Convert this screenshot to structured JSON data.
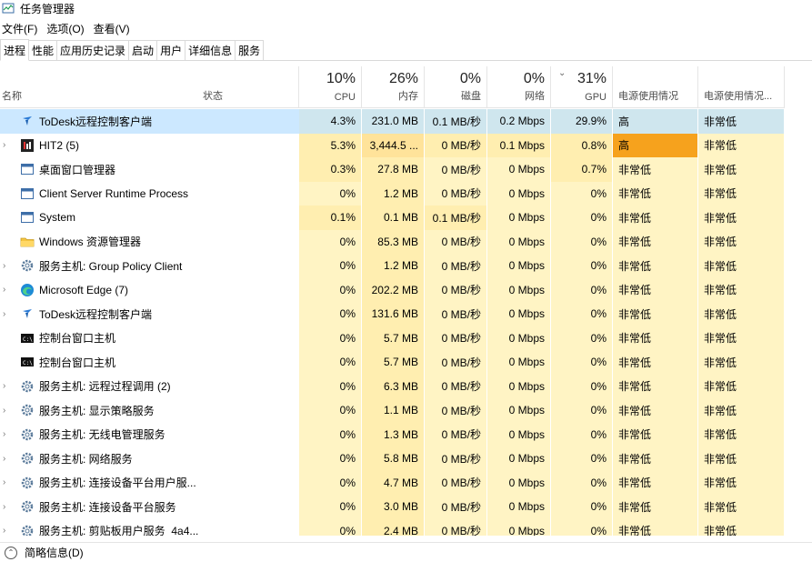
{
  "window": {
    "title": "任务管理器"
  },
  "menu": [
    "文件(F)",
    "选项(O)",
    "查看(V)"
  ],
  "tabs": [
    "进程",
    "性能",
    "应用历史记录",
    "启动",
    "用户",
    "详细信息",
    "服务"
  ],
  "header": {
    "name": "名称",
    "status": "状态",
    "cpu": {
      "pct": "10%",
      "label": "CPU"
    },
    "memory": {
      "pct": "26%",
      "label": "内存"
    },
    "disk": {
      "pct": "0%",
      "label": "磁盘"
    },
    "network": {
      "pct": "0%",
      "label": "网络"
    },
    "gpu": {
      "pct": "31%",
      "label": "GPU"
    },
    "power": "电源使用情况",
    "power_trend": "电源使用情况..."
  },
  "colors": {
    "heat1": "#fff4c4",
    "heat2": "#ffeeb0",
    "heat3": "#ffe39a",
    "power_high": "#f6a21d",
    "selected": "#cce8ff"
  },
  "processes": [
    {
      "expand": "",
      "icon": "todesk-icon",
      "name": "ToDesk远程控制客户端",
      "cpu": "4.3%",
      "mem": "231.0 MB",
      "disk": "0.1 MB/秒",
      "net": "0.2 Mbps",
      "gpu": "29.9%",
      "power": "高",
      "power_trend": "非常低",
      "heat": [
        2,
        2,
        2,
        2,
        2
      ],
      "power_hi": false,
      "selected": true
    },
    {
      "expand": "›",
      "icon": "hit2-icon",
      "name": "HIT2 (5)",
      "cpu": "5.3%",
      "mem": "3,444.5 ...",
      "disk": "0 MB/秒",
      "net": "0.1 Mbps",
      "gpu": "0.8%",
      "power": "高",
      "power_trend": "非常低",
      "heat": [
        2,
        3,
        2,
        2,
        2
      ],
      "power_hi": true,
      "selected": false
    },
    {
      "expand": "",
      "icon": "window-icon",
      "name": "桌面窗口管理器",
      "cpu": "0.3%",
      "mem": "27.8 MB",
      "disk": "0 MB/秒",
      "net": "0 Mbps",
      "gpu": "0.7%",
      "power": "非常低",
      "power_trend": "非常低",
      "heat": [
        2,
        2,
        1,
        1,
        2
      ],
      "power_hi": false,
      "selected": false
    },
    {
      "expand": "",
      "icon": "window-icon",
      "name": "Client Server Runtime Process",
      "cpu": "0%",
      "mem": "1.2 MB",
      "disk": "0 MB/秒",
      "net": "0 Mbps",
      "gpu": "0%",
      "power": "非常低",
      "power_trend": "非常低",
      "heat": [
        1,
        2,
        1,
        1,
        1
      ],
      "power_hi": false,
      "selected": false
    },
    {
      "expand": "",
      "icon": "window-icon",
      "name": "System",
      "cpu": "0.1%",
      "mem": "0.1 MB",
      "disk": "0.1 MB/秒",
      "net": "0 Mbps",
      "gpu": "0%",
      "power": "非常低",
      "power_trend": "非常低",
      "heat": [
        2,
        2,
        2,
        1,
        1
      ],
      "power_hi": false,
      "selected": false
    },
    {
      "expand": "",
      "icon": "folder-icon",
      "name": "Windows 资源管理器",
      "cpu": "0%",
      "mem": "85.3 MB",
      "disk": "0 MB/秒",
      "net": "0 Mbps",
      "gpu": "0%",
      "power": "非常低",
      "power_trend": "非常低",
      "heat": [
        1,
        2,
        1,
        1,
        1
      ],
      "power_hi": false,
      "selected": false
    },
    {
      "expand": "›",
      "icon": "gear-icon",
      "name": "服务主机: Group Policy Client",
      "cpu": "0%",
      "mem": "1.2 MB",
      "disk": "0 MB/秒",
      "net": "0 Mbps",
      "gpu": "0%",
      "power": "非常低",
      "power_trend": "非常低",
      "heat": [
        1,
        2,
        1,
        1,
        1
      ],
      "power_hi": false,
      "selected": false
    },
    {
      "expand": "›",
      "icon": "edge-icon",
      "name": "Microsoft Edge (7)",
      "cpu": "0%",
      "mem": "202.2 MB",
      "disk": "0 MB/秒",
      "net": "0 Mbps",
      "gpu": "0%",
      "power": "非常低",
      "power_trend": "非常低",
      "heat": [
        1,
        2,
        1,
        1,
        1
      ],
      "power_hi": false,
      "selected": false
    },
    {
      "expand": "›",
      "icon": "todesk-icon",
      "name": "ToDesk远程控制客户端",
      "cpu": "0%",
      "mem": "131.6 MB",
      "disk": "0 MB/秒",
      "net": "0 Mbps",
      "gpu": "0%",
      "power": "非常低",
      "power_trend": "非常低",
      "heat": [
        1,
        2,
        1,
        1,
        1
      ],
      "power_hi": false,
      "selected": false
    },
    {
      "expand": "",
      "icon": "console-icon",
      "name": "控制台窗口主机",
      "cpu": "0%",
      "mem": "5.7 MB",
      "disk": "0 MB/秒",
      "net": "0 Mbps",
      "gpu": "0%",
      "power": "非常低",
      "power_trend": "非常低",
      "heat": [
        1,
        2,
        1,
        1,
        1
      ],
      "power_hi": false,
      "selected": false
    },
    {
      "expand": "",
      "icon": "console-icon",
      "name": "控制台窗口主机",
      "cpu": "0%",
      "mem": "5.7 MB",
      "disk": "0 MB/秒",
      "net": "0 Mbps",
      "gpu": "0%",
      "power": "非常低",
      "power_trend": "非常低",
      "heat": [
        1,
        2,
        1,
        1,
        1
      ],
      "power_hi": false,
      "selected": false
    },
    {
      "expand": "›",
      "icon": "gear-icon",
      "name": "服务主机: 远程过程调用 (2)",
      "cpu": "0%",
      "mem": "6.3 MB",
      "disk": "0 MB/秒",
      "net": "0 Mbps",
      "gpu": "0%",
      "power": "非常低",
      "power_trend": "非常低",
      "heat": [
        1,
        2,
        1,
        1,
        1
      ],
      "power_hi": false,
      "selected": false
    },
    {
      "expand": "›",
      "icon": "gear-icon",
      "name": "服务主机: 显示策略服务",
      "cpu": "0%",
      "mem": "1.1 MB",
      "disk": "0 MB/秒",
      "net": "0 Mbps",
      "gpu": "0%",
      "power": "非常低",
      "power_trend": "非常低",
      "heat": [
        1,
        2,
        1,
        1,
        1
      ],
      "power_hi": false,
      "selected": false
    },
    {
      "expand": "›",
      "icon": "gear-icon",
      "name": "服务主机: 无线电管理服务",
      "cpu": "0%",
      "mem": "1.3 MB",
      "disk": "0 MB/秒",
      "net": "0 Mbps",
      "gpu": "0%",
      "power": "非常低",
      "power_trend": "非常低",
      "heat": [
        1,
        2,
        1,
        1,
        1
      ],
      "power_hi": false,
      "selected": false
    },
    {
      "expand": "›",
      "icon": "gear-icon",
      "name": "服务主机: 网络服务",
      "cpu": "0%",
      "mem": "5.8 MB",
      "disk": "0 MB/秒",
      "net": "0 Mbps",
      "gpu": "0%",
      "power": "非常低",
      "power_trend": "非常低",
      "heat": [
        1,
        2,
        1,
        1,
        1
      ],
      "power_hi": false,
      "selected": false
    },
    {
      "expand": "›",
      "icon": "gear-icon",
      "name": "服务主机: 连接设备平台用户服...",
      "cpu": "0%",
      "mem": "4.7 MB",
      "disk": "0 MB/秒",
      "net": "0 Mbps",
      "gpu": "0%",
      "power": "非常低",
      "power_trend": "非常低",
      "heat": [
        1,
        2,
        1,
        1,
        1
      ],
      "power_hi": false,
      "selected": false
    },
    {
      "expand": "›",
      "icon": "gear-icon",
      "name": "服务主机: 连接设备平台服务",
      "cpu": "0%",
      "mem": "3.0 MB",
      "disk": "0 MB/秒",
      "net": "0 Mbps",
      "gpu": "0%",
      "power": "非常低",
      "power_trend": "非常低",
      "heat": [
        1,
        2,
        1,
        1,
        1
      ],
      "power_hi": false,
      "selected": false
    },
    {
      "expand": "›",
      "icon": "gear-icon",
      "name": "服务主机: 剪贴板用户服务_4a4...",
      "cpu": "0%",
      "mem": "2.4 MB",
      "disk": "0 MB/秒",
      "net": "0 Mbps",
      "gpu": "0%",
      "power": "非常低",
      "power_trend": "非常低",
      "heat": [
        1,
        2,
        1,
        1,
        1
      ],
      "power_hi": false,
      "selected": false
    }
  ],
  "footer": {
    "label": "简略信息(D)"
  }
}
